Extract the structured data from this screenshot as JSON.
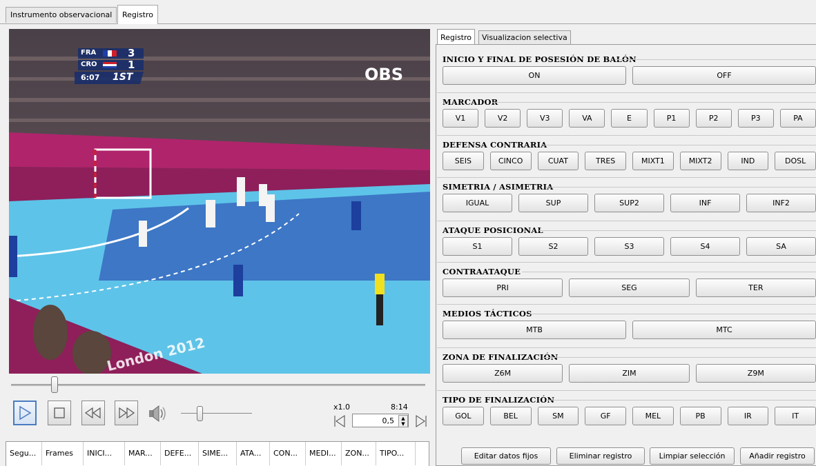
{
  "tabs": {
    "tab1": "Instrumento observacional",
    "tab2": "Registro"
  },
  "video": {
    "scoreboard": {
      "team1": "FRA",
      "score1": "3",
      "team2": "CRO",
      "score2": "1",
      "clock": "6:07",
      "period": "1ST"
    },
    "broadcaster": "OBS",
    "banner_text": "London 2012"
  },
  "player": {
    "speed": "x1.0",
    "time": "8:14",
    "frame_step": "0,5",
    "seek_fraction": 0.11,
    "volume_fraction": 0.25
  },
  "table": {
    "columns": [
      "Segu...",
      "Frames",
      "INICI...",
      "MAR...",
      "DEFE...",
      "SIME...",
      "ATA...",
      "CON...",
      "MEDI...",
      "ZON...",
      "TIPO..."
    ]
  },
  "panel": {
    "tab1": "Registro",
    "tab2": "Visualizacion selectiva",
    "sections": [
      {
        "title": "INICIO Y FINAL DE POSESIÓN DE BALÓN",
        "buttons": [
          "ON",
          "OFF"
        ]
      },
      {
        "title": "MARCADOR",
        "buttons": [
          "V1",
          "V2",
          "V3",
          "VA",
          "E",
          "P1",
          "P2",
          "P3",
          "PA"
        ]
      },
      {
        "title": "DEFENSA CONTRARIA",
        "buttons": [
          "SEIS",
          "CINCO",
          "CUAT",
          "TRES",
          "MIXT1",
          "MIXT2",
          "IND",
          "DOSL"
        ]
      },
      {
        "title": "SIMETRIA / ASIMETRIA",
        "buttons": [
          "IGUAL",
          "SUP",
          "SUP2",
          "INF",
          "INF2"
        ]
      },
      {
        "title": "ATAQUE POSICIONAL",
        "buttons": [
          "S1",
          "S2",
          "S3",
          "S4",
          "SA"
        ]
      },
      {
        "title": "CONTRAATAQUE",
        "buttons": [
          "PRI",
          "SEG",
          "TER"
        ]
      },
      {
        "title": "MEDIOS TÁCTICOS",
        "buttons": [
          "MTB",
          "MTC"
        ]
      },
      {
        "title": "ZONA DE FINALIZACIÓN",
        "buttons": [
          "Z6M",
          "ZIM",
          "Z9M"
        ]
      },
      {
        "title": "TIPO DE FINALIZACIÓN",
        "buttons": [
          "GOL",
          "BEL",
          "SM",
          "GF",
          "MEL",
          "PB",
          "IR",
          "IT"
        ]
      }
    ],
    "actions": {
      "edit": "Editar datos fijos",
      "delete": "Eliminar registro",
      "clear": "Limpiar selección",
      "add": "Añadir registro"
    }
  },
  "colors": {
    "court": "#5ec3e8",
    "court_center": "#3d77c6",
    "stands": "#b0246c",
    "accent": "#4a7bbf"
  }
}
